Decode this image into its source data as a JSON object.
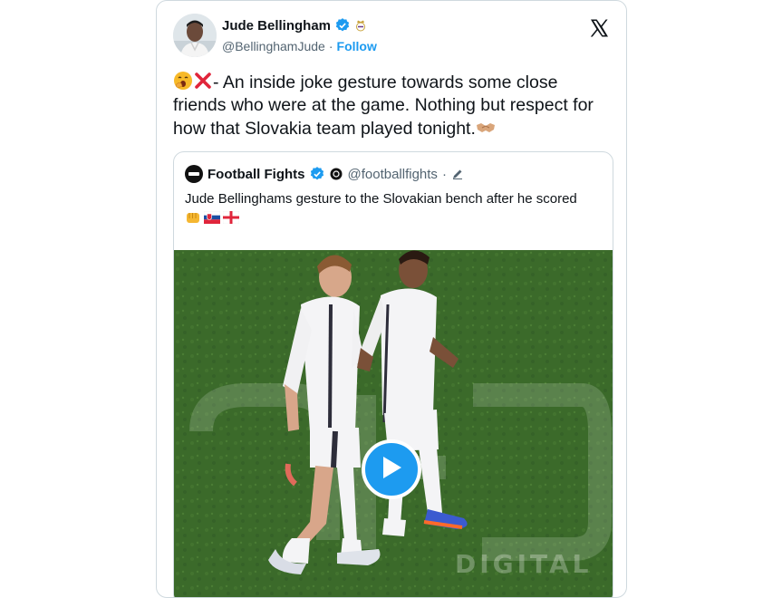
{
  "tweet": {
    "author_name": "Jude Bellingham",
    "handle": "@BellinghamJude",
    "separator": "·",
    "follow_label": "Follow",
    "text": "- An inside joke gesture towards some close friends who were at the game. Nothing but respect for how that Slovakia team played tonight.",
    "icons": {
      "verified": "verified-badge-icon",
      "affiliate": "real-madrid-crest-icon",
      "platform": "x-logo-icon"
    }
  },
  "quoted_tweet": {
    "author_name": "Football Fights",
    "handle": "@footballfights",
    "separator": "·",
    "text": "Jude Bellinghams gesture to the Slovakian bench after he scored",
    "emojis": [
      "fist-emoji",
      "slovakia-flag-emoji",
      "england-flag-emoji"
    ]
  },
  "media": {
    "type": "video",
    "watermark": "DIGITAL"
  },
  "colors": {
    "accent": "#1d9bf0",
    "text": "#0f1419",
    "muted": "#536471",
    "border": "#cfd9de"
  }
}
